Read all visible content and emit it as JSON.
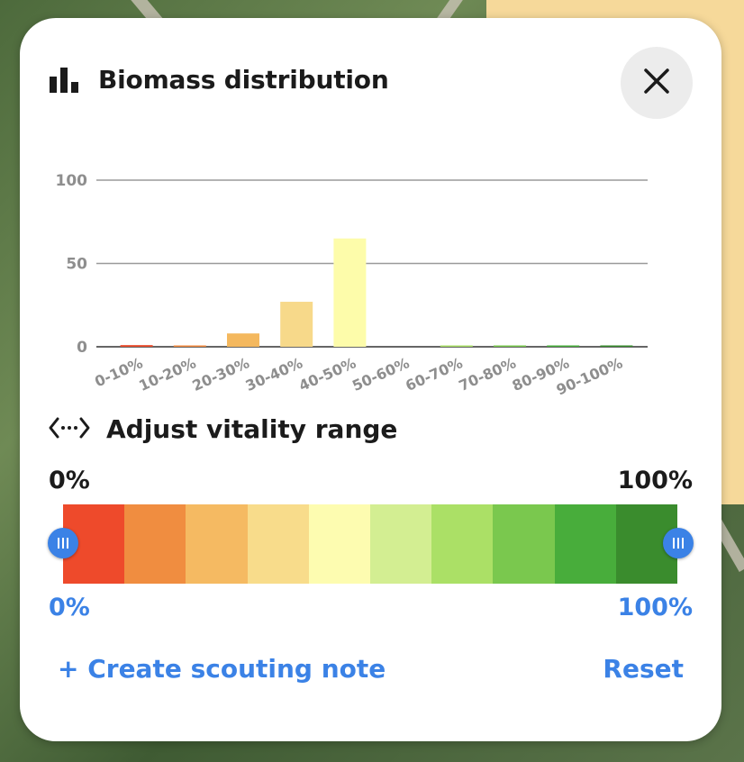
{
  "panel": {
    "title": "Biomass distribution",
    "close_icon": "close-icon",
    "chart_icon": "bar-chart-icon"
  },
  "chart_data": {
    "type": "bar",
    "categories": [
      "0-10%",
      "10-20%",
      "20-30%",
      "30-40%",
      "40-50%",
      "50-60%",
      "60-70%",
      "70-80%",
      "80-90%",
      "90-100%"
    ],
    "values": [
      1,
      0.5,
      8,
      27,
      65,
      0,
      0.5,
      0.5,
      0.5,
      0.5
    ],
    "colors": [
      "#e84a2a",
      "#f0893e",
      "#f4b85e",
      "#f7d98a",
      "#fdfcaa",
      "#d2ef8e",
      "#a8df66",
      "#77c74d",
      "#47ad3b",
      "#378b2c"
    ],
    "yticks": [
      0,
      50,
      100
    ],
    "ylim": [
      0,
      100
    ],
    "grid": true,
    "xlabel": "",
    "ylabel": ""
  },
  "vitality": {
    "title": "Adjust vitality range",
    "icon": "range-arrows-icon",
    "min_label": "0%",
    "max_label": "100%",
    "range_min": "0%",
    "range_max": "100%",
    "segment_colors": [
      "#ee4a2b",
      "#f08d40",
      "#f5ba62",
      "#f8dc8b",
      "#fdfcb0",
      "#d3ee92",
      "#abe066",
      "#7ac84e",
      "#48ad3b",
      "#3a8c2d"
    ]
  },
  "actions": {
    "create_note": "+ Create scouting note",
    "reset": "Reset"
  }
}
